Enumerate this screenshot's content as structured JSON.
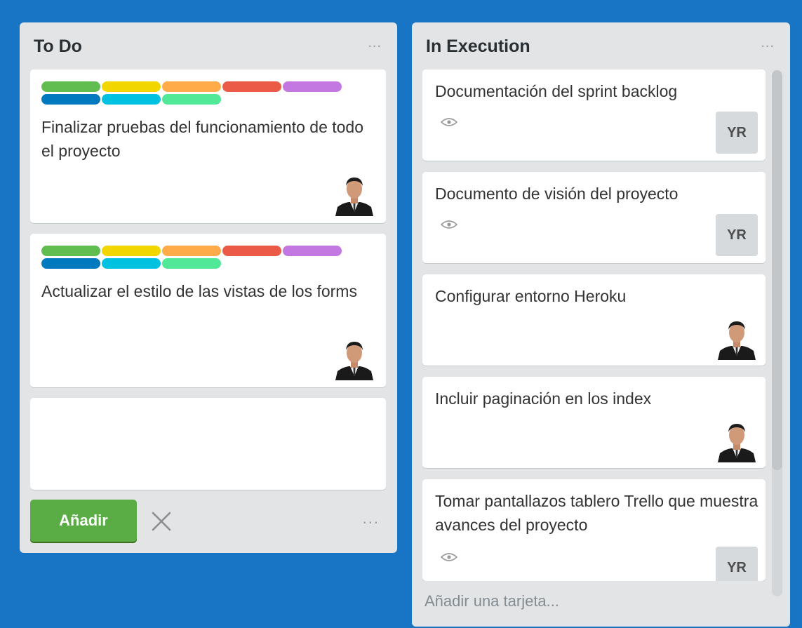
{
  "colors": {
    "board_bg": "#1874c4",
    "list_bg": "#e2e4e6",
    "add_button": "#5aac44"
  },
  "label_colors": [
    "#61bd4f",
    "#f2d600",
    "#ffab4a",
    "#eb5a46",
    "#c377e0",
    "#0079bf",
    "#00c2e0",
    "#51e898"
  ],
  "todo": {
    "title": "To Do",
    "menu": "...",
    "cards": [
      {
        "text": "Finalizar pruebas del funcionamiento de todo el proyecto",
        "member": "photo"
      },
      {
        "text": "Actualizar el estilo de las vistas de los forms",
        "member": "photo"
      }
    ],
    "composer": {
      "value": "",
      "add_label": "Añadir",
      "close_icon": "close-icon",
      "menu": "..."
    }
  },
  "exec": {
    "title": "In Execution",
    "menu": "...",
    "cards": [
      {
        "text": "Documentación del sprint backlog",
        "watch": true,
        "member": "YR"
      },
      {
        "text": "Documento de visión del proyecto",
        "watch": true,
        "member": "YR"
      },
      {
        "text": "Configurar entorno Heroku",
        "watch": false,
        "member": "photo"
      },
      {
        "text": "Incluir paginación en los index",
        "watch": false,
        "member": "photo"
      },
      {
        "text": "Tomar pantallazos tablero Trello que muestra avances del proyecto",
        "watch": true,
        "member": "YR"
      }
    ],
    "add_card": "Añadir una tarjeta..."
  }
}
